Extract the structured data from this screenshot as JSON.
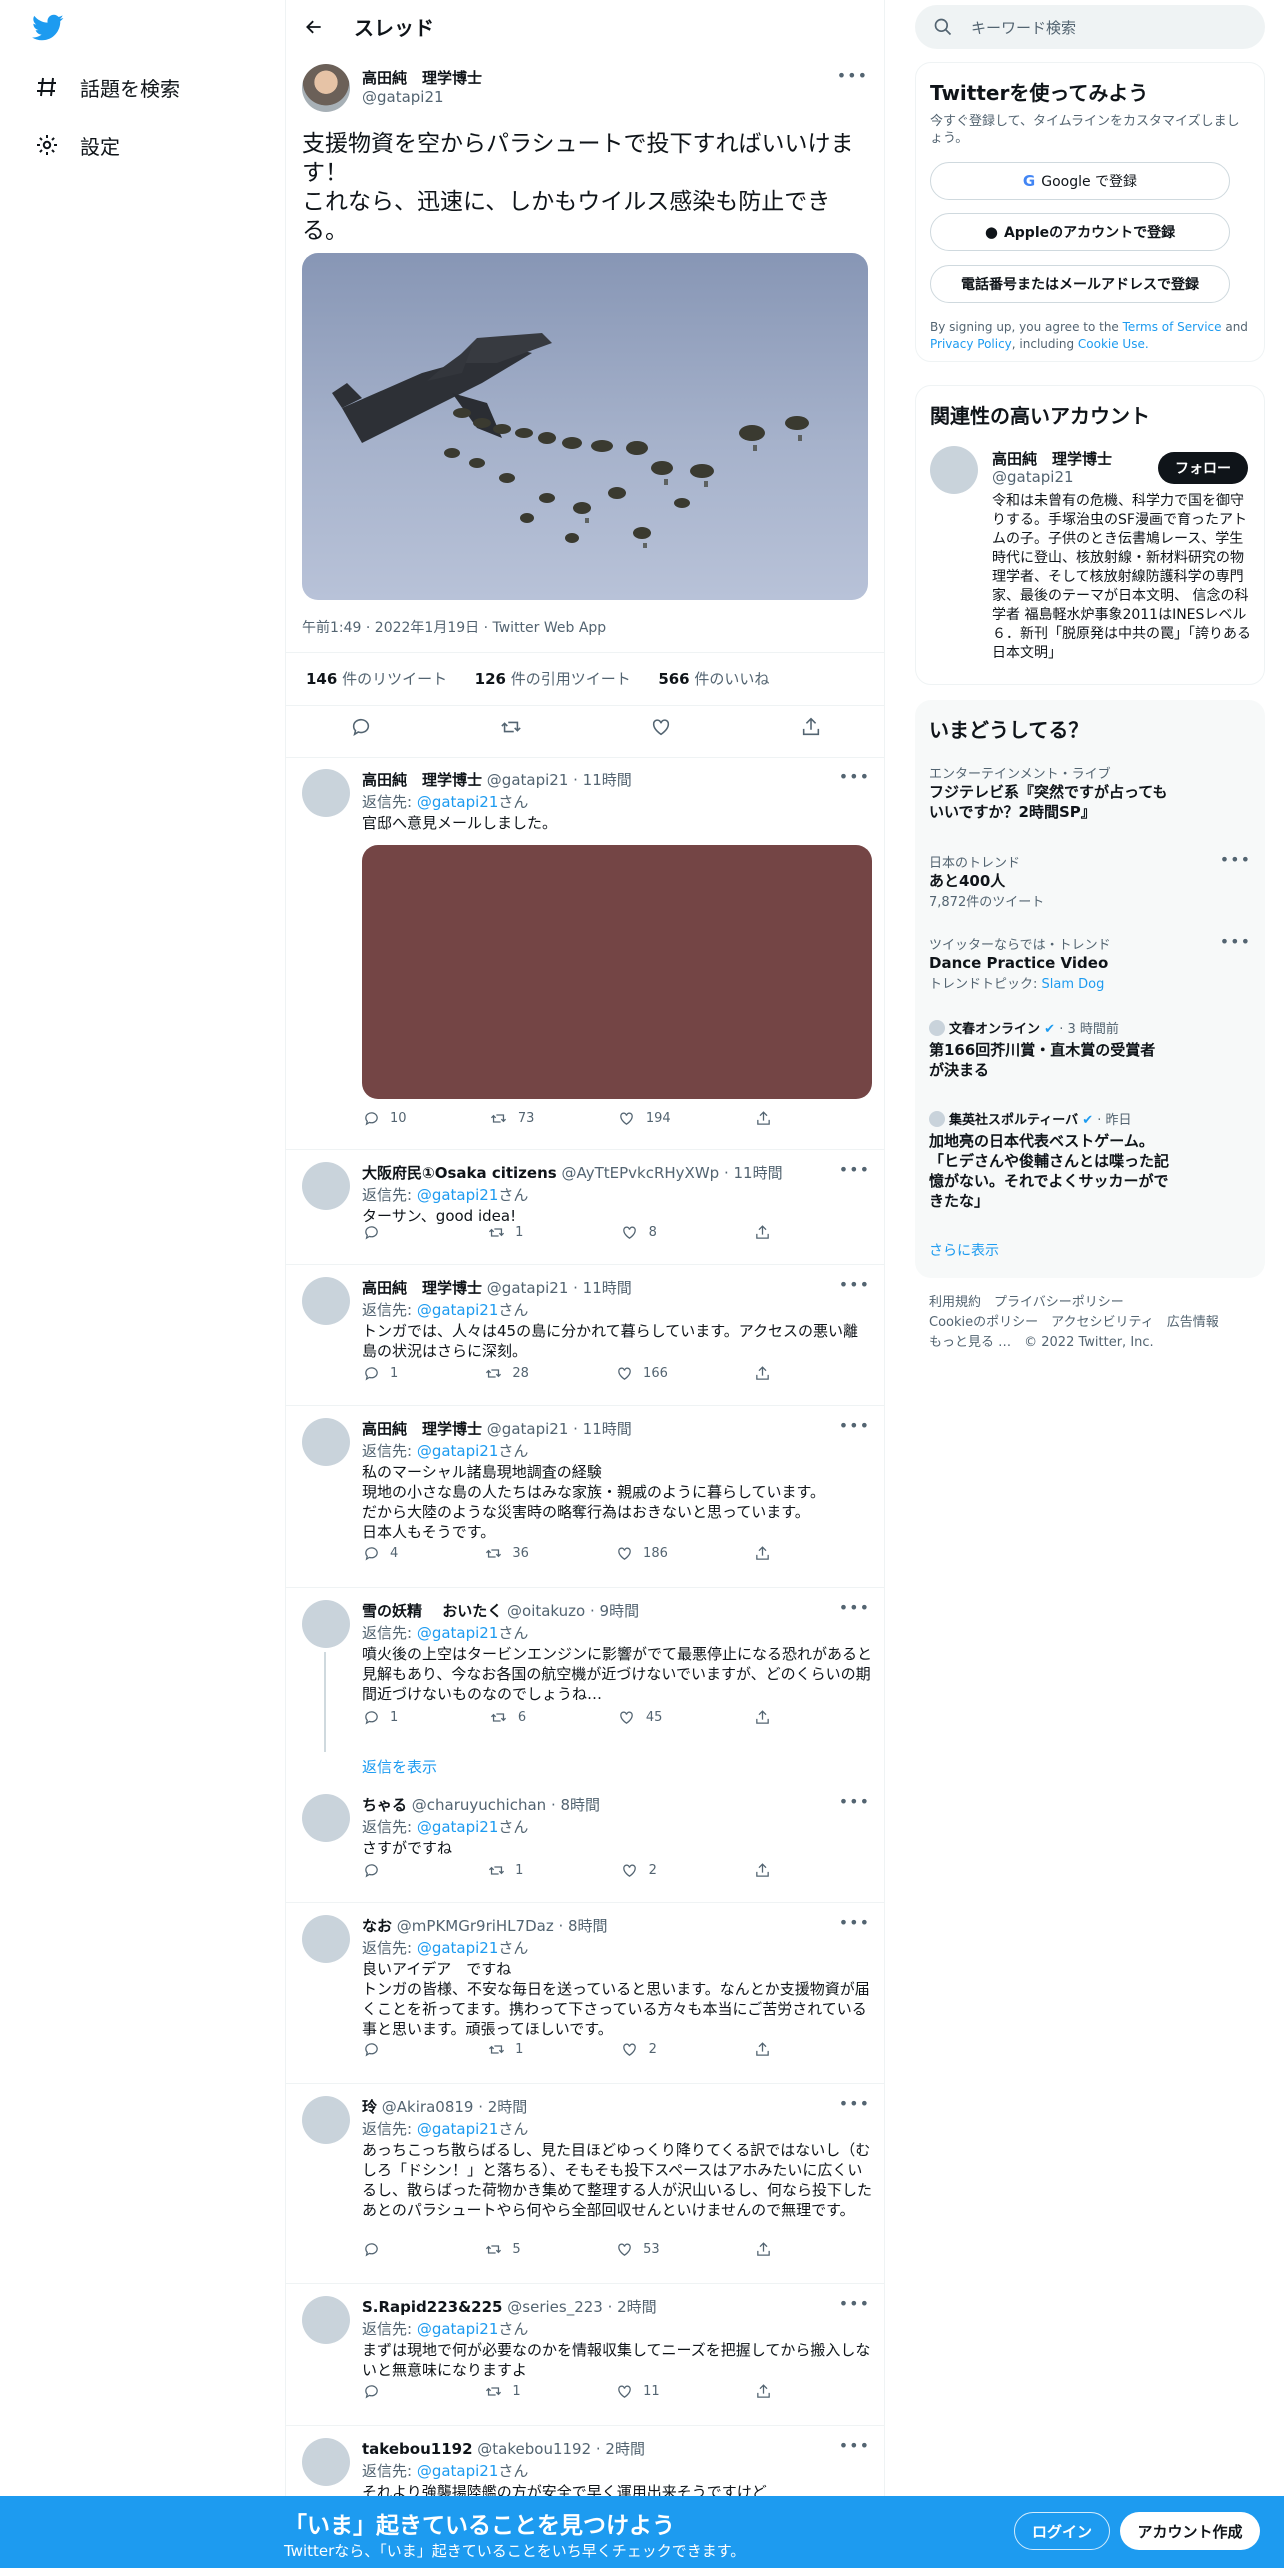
{
  "nav": {
    "explore": "話題を検索",
    "settings": "設定"
  },
  "header": {
    "title": "スレッド"
  },
  "tweet": {
    "author_name": "高田純　理学博士",
    "author_handle": "@gatapi21",
    "text": "支援物資を空からパラシュートで投下すればいいけます！\nこれなら、迅速に、しかもウイルス感染も防止できる。",
    "meta": "午前1:49 · 2022年1月19日 · Twitter Web App",
    "retweets_count": "146",
    "retweets_label": " 件のリツイート",
    "quotes_count": "126",
    "quotes_label": " 件の引用ツイート",
    "likes_count": "566",
    "likes_label": " 件のいいね"
  },
  "replies": [
    {
      "name": "高田純　理学博士",
      "handle": "@gatapi21 · 11時間",
      "reply_to_prefix": "返信先: ",
      "reply_to": "@gatapi21",
      "reply_to_suffix": "さん",
      "text": "官邸へ意見メールしました。",
      "reply_count": "10",
      "retweet_count": "73",
      "like_count": "194"
    },
    {
      "name": "大阪府民①Osaka citizens",
      "handle": "@AyTtEPvkcRHyXWp · 11時間",
      "reply_to_prefix": "返信先: ",
      "reply_to": "@gatapi21",
      "reply_to_suffix": "さん",
      "text": "ターサン、good idea!",
      "reply_count": "",
      "retweet_count": "1",
      "like_count": "8"
    },
    {
      "name": "高田純　理学博士",
      "handle": "@gatapi21 · 11時間",
      "reply_to_prefix": "返信先: ",
      "reply_to": "@gatapi21",
      "reply_to_suffix": "さん",
      "text": "トンガでは、人々は45の島に分かれて暮らしています。アクセスの悪い離島の状況はさらに深刻。",
      "reply_count": "1",
      "retweet_count": "28",
      "like_count": "166"
    },
    {
      "name": "高田純　理学博士",
      "handle": "@gatapi21 · 11時間",
      "reply_to_prefix": "返信先: ",
      "reply_to": "@gatapi21",
      "reply_to_suffix": "さん",
      "text": "私のマーシャル諸島現地調査の経験\n現地の小さな島の人たちはみな家族・親戚のように暮らしています。\nだから大陸のような災害時の略奪行為はおきないと思っています。\n日本人もそうです。",
      "reply_count": "4",
      "retweet_count": "36",
      "like_count": "186"
    },
    {
      "name": "雪の妖精　 おいたく",
      "handle": "@oitakuzo · 9時間",
      "reply_to_prefix": "返信先: ",
      "reply_to": "@gatapi21",
      "reply_to_suffix": "さん",
      "text": "噴火後の上空はタービンエンジンに影響がでて最悪停止になる恐れがあると見解もあり、今なお各国の航空機が近づけないでいますが、どのくらいの期間近づけないものなのでしょうね…",
      "reply_count": "1",
      "retweet_count": "6",
      "like_count": "45",
      "show_replies": "返信を表示"
    },
    {
      "name": "ちゃる",
      "handle": "@charuyuchichan · 8時間",
      "reply_to_prefix": "返信先: ",
      "reply_to": "@gatapi21",
      "reply_to_suffix": "さん",
      "text": "さすがですね",
      "reply_count": "",
      "retweet_count": "1",
      "like_count": "2"
    },
    {
      "name": "なお",
      "handle": "@mPKMGr9riHL7Daz · 8時間",
      "reply_to_prefix": "返信先: ",
      "reply_to": "@gatapi21",
      "reply_to_suffix": "さん",
      "text": "良いアイデア　ですね\nトンガの皆様、不安な毎日を送っていると思います。なんとか支援物資が届くことを祈ってます。携わって下さっている方々も本当にご苦労されている事と思います。頑張ってほしいです。",
      "reply_count": "",
      "retweet_count": "1",
      "like_count": "2"
    },
    {
      "name": "玲",
      "handle": "@Akira0819 · 2時間",
      "reply_to_prefix": "返信先: ",
      "reply_to": "@gatapi21",
      "reply_to_suffix": "さん",
      "text": "あっちこっち散らばるし、見た目ほどゆっくり降りてくる訳ではないし（むしろ「ドシン！」と落ちる）、そもそも投下スペースはアホみたいに広くいるし、散らばった荷物かき集めて整理する人が沢山いるし、何なら投下したあとのパラシュートやら何やら全部回収せんといけませんので無理です。",
      "reply_count": "",
      "retweet_count": "5",
      "like_count": "53"
    },
    {
      "name": "S.Rapid223&225",
      "handle": "@series_223 · 2時間",
      "reply_to_prefix": "返信先: ",
      "reply_to": "@gatapi21",
      "reply_to_suffix": "さん",
      "text": "まずは現地で何が必要なのかを情報収集してニーズを把握してから搬入しないと無意味になりますよ",
      "reply_count": "",
      "retweet_count": "1",
      "like_count": "11"
    },
    {
      "name": "takebou1192",
      "handle": "@takebou1192 · 2時間",
      "reply_to_prefix": "返信先: ",
      "reply_to": "@gatapi21",
      "reply_to_suffix": "さん",
      "text": "それより強襲揚陸艦の方が安全で早く運用出来そうですけど",
      "reply_count": "",
      "retweet_count": "",
      "like_count": ""
    }
  ],
  "right": {
    "search_placeholder": "キーワード検索",
    "signup": {
      "title": "Twitterを使ってみよう",
      "subtitle": "今すぐ登録して、タイムラインをカスタマイズしましょう。",
      "google": "Google で登録",
      "apple": "Appleのアカウントで登録",
      "phone": "電話番号またはメールアドレスで登録",
      "terms_pre": "By signing up, you agree to the ",
      "terms_link": "Terms of Service",
      "terms_and": " and ",
      "privacy_link": "Privacy Policy",
      "terms_including": ", including ",
      "cookie_link": "Cookie Use."
    },
    "related": {
      "title": "関連性の高いアカウント",
      "name": "高田純　理学博士",
      "handle": "@gatapi21",
      "follow": "フォロー",
      "bio": "令和は未曾有の危機、科学力で国を御守りする。手塚治虫のSF漫画で育ったアトムの子。子供のとき伝書鳩レース、学生時代に登山、核放射線・新材料研究の物理学者、そして核放射線防護科学の専門家、最後のテーマが日本文明、 信念の科学者 福島軽水炉事象2011はINESレベル６．新刊「脱原発は中共の罠」「誇りある日本文明」"
    },
    "trends": {
      "title": "いまどうしてる？",
      "items": [
        {
          "meta": "エンターテインメント・ライブ",
          "title": "フジテレビ系『突然ですが占ってもいいですか？2時間SP』"
        },
        {
          "meta": "日本のトレンド",
          "title": "あと400人",
          "sub": "7,872件のツイート"
        },
        {
          "meta": "ツイッターならでは・トレンド",
          "title": "Dance Practice Video",
          "sub_pre": "トレンドトピック: ",
          "sub_link": "Slam Dog"
        },
        {
          "source": "文春オンライン",
          "time": " · 3 時間前",
          "title": "第166回芥川賞・直木賞の受賞者が決まる"
        },
        {
          "source": "集英社スポルティーバ",
          "time": " · 昨日",
          "title": "加地亮の日本代表ベストゲーム。「ヒデさんや俊輔さんとは喋った記憶がない。それでよくサッカーができたな」"
        }
      ],
      "more": "さらに表示"
    },
    "footer": {
      "line1": "利用規約　プライバシーポリシー",
      "line2": "Cookieのポリシー　アクセシビリティ　広告情報",
      "line3": "もっと見る …　© 2022 Twitter, Inc."
    }
  },
  "bottombar": {
    "title": "「いま」起きていることを見つけよう",
    "subtitle": "Twitterなら、「いま」起きていることをいち早くチェックできます。",
    "login": "ログイン",
    "signup": "アカウント作成"
  },
  "colors": {
    "brand": "#1d9bf0",
    "text": "#0f1419",
    "muted": "#536471",
    "reply_image": "#744545"
  }
}
